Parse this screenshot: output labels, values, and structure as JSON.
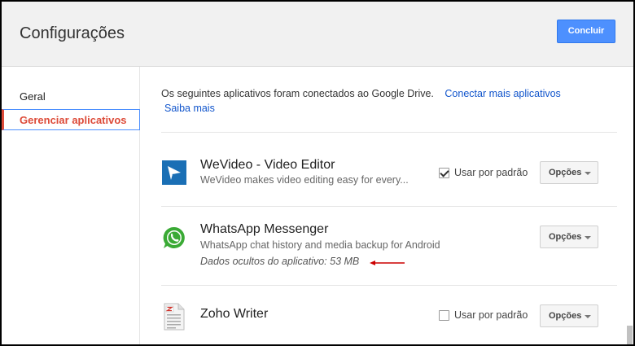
{
  "header": {
    "title": "Configurações",
    "done_label": "Concluir"
  },
  "sidebar": {
    "items": [
      {
        "label": "Geral",
        "active": false
      },
      {
        "label": "Gerenciar aplicativos",
        "active": true
      }
    ]
  },
  "main": {
    "intro_text": "Os seguintes aplicativos foram conectados ao Google Drive.",
    "connect_link": "Conectar mais aplicativos",
    "learn_more_link": "Saiba mais",
    "apps": [
      {
        "name": "WeVideo - Video Editor",
        "description": "WeVideo makes video editing easy for every...",
        "default_label": "Usar por padrão",
        "default_checked": true,
        "options_label": "Opções",
        "icon": "wevideo-icon"
      },
      {
        "name": "WhatsApp Messenger",
        "description": "WhatsApp chat history and media backup for Android",
        "hidden_data": "Dados ocultos do aplicativo: 53 MB",
        "options_label": "Opções",
        "icon": "whatsapp-icon"
      },
      {
        "name": "Zoho Writer",
        "default_label": "Usar por padrão",
        "default_checked": false,
        "options_label": "Opções",
        "icon": "zoho-writer-icon"
      }
    ]
  },
  "colors": {
    "accent_blue": "#4d90fe",
    "active_red": "#dd4b39",
    "link_blue": "#1155cc",
    "annotation_arrow": "#cc0000"
  }
}
